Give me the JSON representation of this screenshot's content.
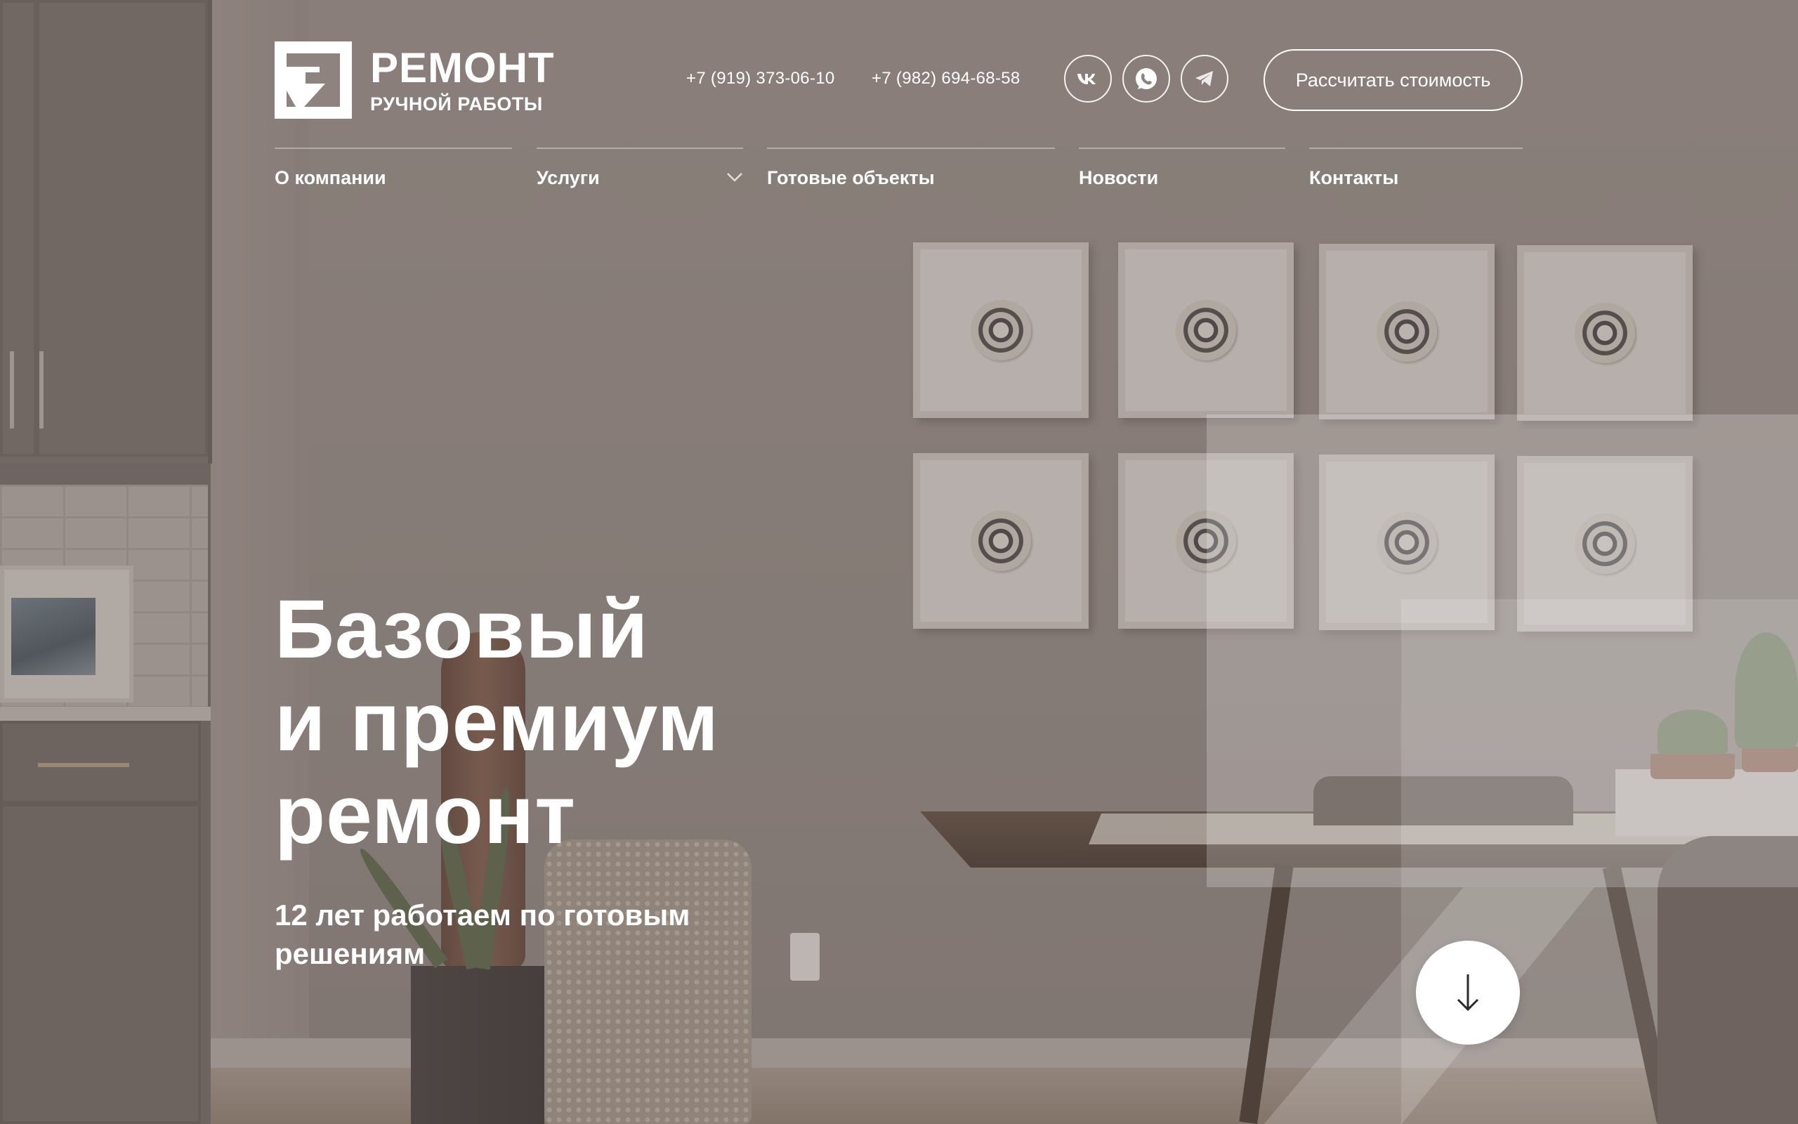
{
  "brand": {
    "title": "РЕМОНТ",
    "subtitle": "РУЧНОЙ РАБОТЫ"
  },
  "header": {
    "phones": [
      "+7 (919) 373-06-10",
      "+7 (982) 694-68-58"
    ],
    "socials": [
      {
        "name": "vk-icon",
        "glyph": "vk"
      },
      {
        "name": "whatsapp-icon"
      },
      {
        "name": "telegram-icon"
      }
    ],
    "cta_label": "Рассчитать стоимость"
  },
  "nav": {
    "items": [
      {
        "label": "О компании"
      },
      {
        "label": "Услуги",
        "has_dropdown": true
      },
      {
        "label": "Готовые объекты"
      },
      {
        "label": "Новости"
      },
      {
        "label": "Контакты"
      }
    ]
  },
  "hero": {
    "title_lines": [
      "Базовый",
      "и премиум",
      "ремонт"
    ],
    "subtitle_line1": "12 лет работаем по готовым",
    "subtitle_line2": "решениям"
  },
  "colors": {
    "accent": "#ffffff",
    "overlay": "#6e6460"
  },
  "icons": {
    "scroll": "arrow-down-icon",
    "chevron": "chevron-down-icon"
  }
}
